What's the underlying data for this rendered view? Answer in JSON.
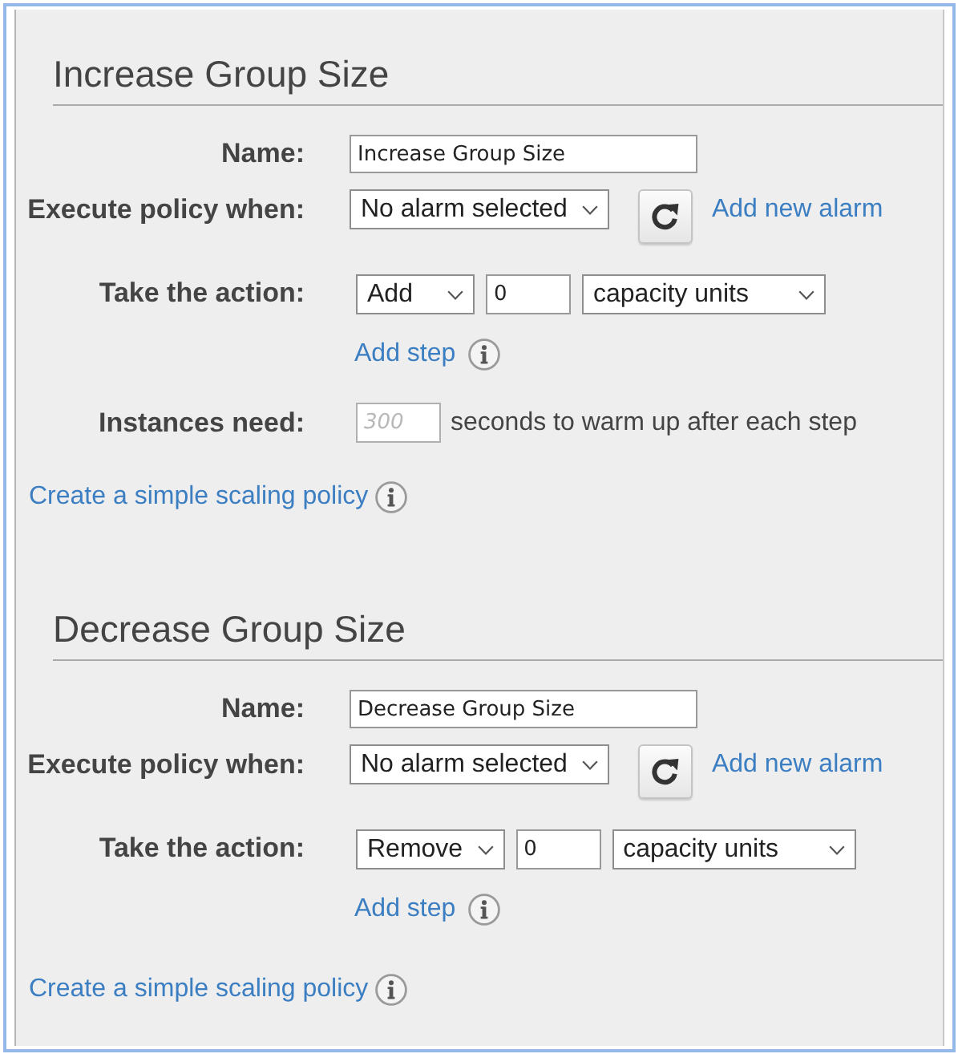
{
  "sections": [
    {
      "title": "Increase Group Size",
      "fields": [
        {
          "kind": "text",
          "label": "Name:",
          "value": "Increase Group Size"
        },
        {
          "kind": "alarm",
          "label": "Execute policy when:",
          "value": "No alarm selected",
          "link": "Add new alarm"
        },
        {
          "kind": "action",
          "label": "Take the action:",
          "operation": "Add",
          "amount": "0",
          "unit": "capacity units",
          "add_step_link": "Add step"
        },
        {
          "kind": "warmup",
          "label": "Instances need:",
          "placeholder": "300",
          "suffix": "seconds to warm up after each step"
        }
      ],
      "footer_link": "Create a simple scaling policy"
    },
    {
      "title": "Decrease Group Size",
      "fields": [
        {
          "kind": "text",
          "label": "Name:",
          "value": "Decrease Group Size"
        },
        {
          "kind": "alarm",
          "label": "Execute policy when:",
          "value": "No alarm selected",
          "link": "Add new alarm"
        },
        {
          "kind": "action",
          "label": "Take the action:",
          "operation": "Remove",
          "amount": "0",
          "unit": "capacity units",
          "add_step_link": "Add step"
        }
      ],
      "footer_link": "Create a simple scaling policy"
    }
  ]
}
